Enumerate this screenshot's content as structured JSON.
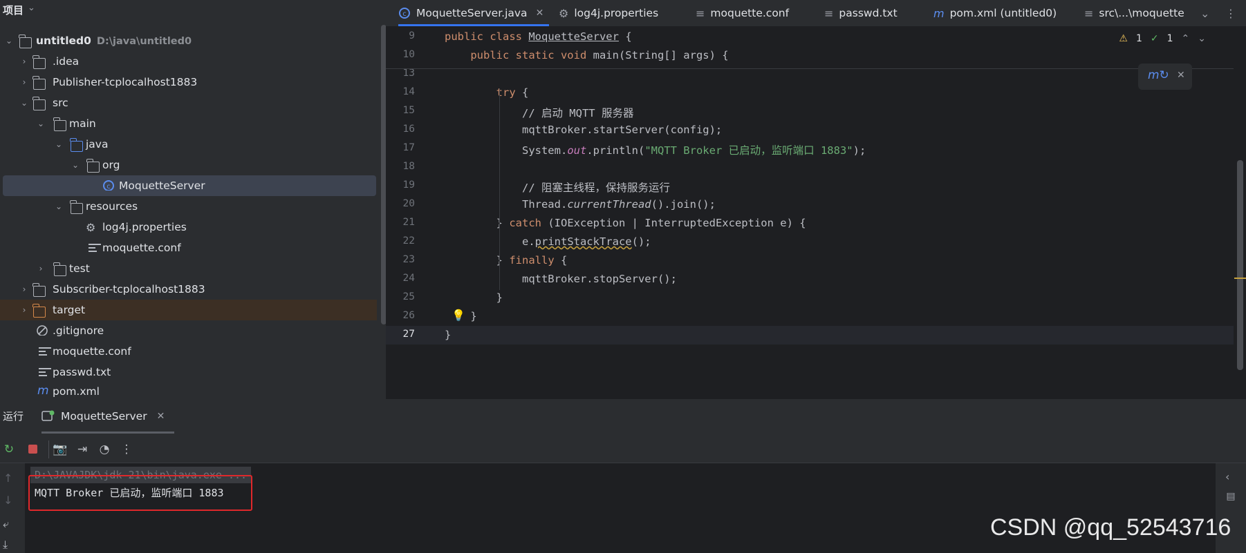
{
  "project": {
    "title": "项目",
    "tree": [
      {
        "label": "untitled0",
        "path": "D:\\java\\untitled0",
        "icon": "module-folder-icon"
      },
      {
        "label": ".idea",
        "icon": "folder-icon"
      },
      {
        "label": "Publisher-tcplocalhost1883",
        "icon": "folder-icon"
      },
      {
        "label": "src",
        "icon": "folder-icon"
      },
      {
        "label": "main",
        "icon": "folder-icon"
      },
      {
        "label": "java",
        "icon": "source-folder-icon"
      },
      {
        "label": "org",
        "icon": "package-icon"
      },
      {
        "label": "MoquetteServer",
        "icon": "java-class-icon"
      },
      {
        "label": "resources",
        "icon": "resources-folder-icon"
      },
      {
        "label": "log4j.properties",
        "icon": "gear-icon"
      },
      {
        "label": "moquette.conf",
        "icon": "text-file-icon"
      },
      {
        "label": "test",
        "icon": "folder-icon"
      },
      {
        "label": "Subscriber-tcplocalhost1883",
        "icon": "folder-icon"
      },
      {
        "label": "target",
        "icon": "excluded-folder-icon"
      },
      {
        "label": ".gitignore",
        "icon": "ignore-file-icon"
      },
      {
        "label": "moquette.conf",
        "icon": "text-file-icon"
      },
      {
        "label": "passwd.txt",
        "icon": "text-file-icon"
      },
      {
        "label": "pom.xml",
        "icon": "maven-icon"
      }
    ]
  },
  "tabs": [
    {
      "label": "MoquetteServer.java",
      "icon": "java-class-icon",
      "active": true
    },
    {
      "label": "log4j.properties",
      "icon": "gear-icon"
    },
    {
      "label": "moquette.conf",
      "icon": "text-file-icon"
    },
    {
      "label": "passwd.txt",
      "icon": "text-file-icon"
    },
    {
      "label": "pom.xml (untitled0)",
      "icon": "maven-icon"
    },
    {
      "label": "src\\...\\moquette",
      "icon": "text-file-icon"
    }
  ],
  "inspections": {
    "warnings": "1",
    "ok": "1"
  },
  "code": [
    {
      "num": "9"
    },
    {
      "num": "10"
    },
    {
      "num": "13"
    },
    {
      "num": "14"
    },
    {
      "num": "15"
    },
    {
      "num": "16"
    },
    {
      "num": "17"
    },
    {
      "num": "18"
    },
    {
      "num": "19"
    },
    {
      "num": "20"
    },
    {
      "num": "21"
    },
    {
      "num": "22"
    },
    {
      "num": "23"
    },
    {
      "num": "24"
    },
    {
      "num": "25"
    },
    {
      "num": "26"
    },
    {
      "num": "27"
    }
  ],
  "code_text": {
    "l9a": "public class ",
    "l9b": "MoquetteServer",
    "l9c": " {",
    "l10a": "    public static void ",
    "l10b": "main(String[] args) {",
    "l14a": "        ",
    "l14b": "try",
    " l14c": " {",
    "l15": "            // 启动 MQTT 服务器",
    "l16": "            mqttBroker.startServer(config);",
    "l17a": "            System.",
    "l17b": "out",
    "l17c": ".println(",
    "l17d": "\"MQTT Broker 已启动，监听端口 1883\"",
    "l17e": ");",
    "l19": "            // 阻塞主线程，保持服务运行",
    "l20a": "            Thread.",
    "l20b": "currentThread",
    "l20c": "().join();",
    "l21a": "        } ",
    "l21b": "catch",
    " l21c": " (IOException | InterruptedException e) {",
    "l22a": "            e.",
    "l22b": "printStackTrace",
    "l22c": "();",
    "l23a": "        } ",
    "l23b": "finally",
    " l23c": " {",
    "l24": "            mqttBroker.stopServer();",
    "l25": "        }",
    "l26": "    }",
    "l27": "}"
  },
  "run": {
    "label": "运行",
    "tab": "MoquetteServer",
    "cmd": "D:\\JAVAJDK\\jdk-21\\bin\\java.exe ...",
    "output": "MQTT Broker 已启动，监听端口 1883"
  },
  "watermark": "CSDN @qq_52543716",
  "colors": {
    "accent": "#3574f0",
    "keyword": "#cf8e6d",
    "comment": "#7a7e85",
    "string": "#6aab73",
    "highlight_box": "#e0282b"
  }
}
